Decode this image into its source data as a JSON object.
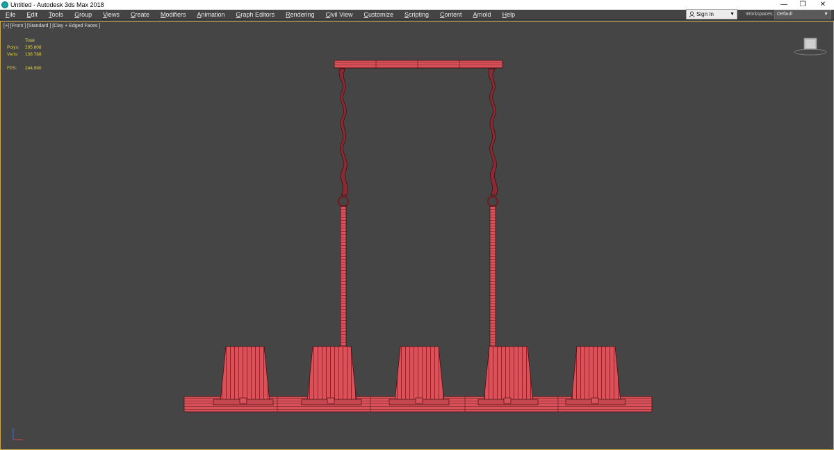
{
  "window": {
    "title": "Untitled - Autodesk 3ds Max 2018",
    "minimize_glyph": "—",
    "maximize_glyph": "❐",
    "close_glyph": "✕"
  },
  "menu": [
    {
      "label": "File"
    },
    {
      "label": "Edit"
    },
    {
      "label": "Tools"
    },
    {
      "label": "Group"
    },
    {
      "label": "Views"
    },
    {
      "label": "Create"
    },
    {
      "label": "Modifiers"
    },
    {
      "label": "Animation"
    },
    {
      "label": "Graph Editors"
    },
    {
      "label": "Rendering"
    },
    {
      "label": "Civil View"
    },
    {
      "label": "Customize"
    },
    {
      "label": "Scripting"
    },
    {
      "label": "Content"
    },
    {
      "label": "Arnold"
    },
    {
      "label": "Help"
    }
  ],
  "account": {
    "sign_in_label": "Sign In",
    "workspaces_label": "Workspaces:",
    "workspace_value": "Default"
  },
  "viewport": {
    "label": "[+] [Front ] [Standard ] [Clay + Edged Faces ]",
    "stats": {
      "header": "Total",
      "polys_label": "Polys:",
      "polys_value": "295 808",
      "verts_label": "Verts:",
      "verts_value": "138 788",
      "fps_label": "FPS:",
      "fps_value": "244,990"
    },
    "object_color": "#d9525a",
    "wire_color": "#4a1015",
    "frame_color": "#cda74a",
    "background_color": "#454545"
  },
  "icons": {
    "app": "3ds-max-icon",
    "account": "user-icon",
    "dropdown": "chevron-down-icon",
    "navigation": "viewcube-icon",
    "axes": "axis-tripod-icon"
  }
}
